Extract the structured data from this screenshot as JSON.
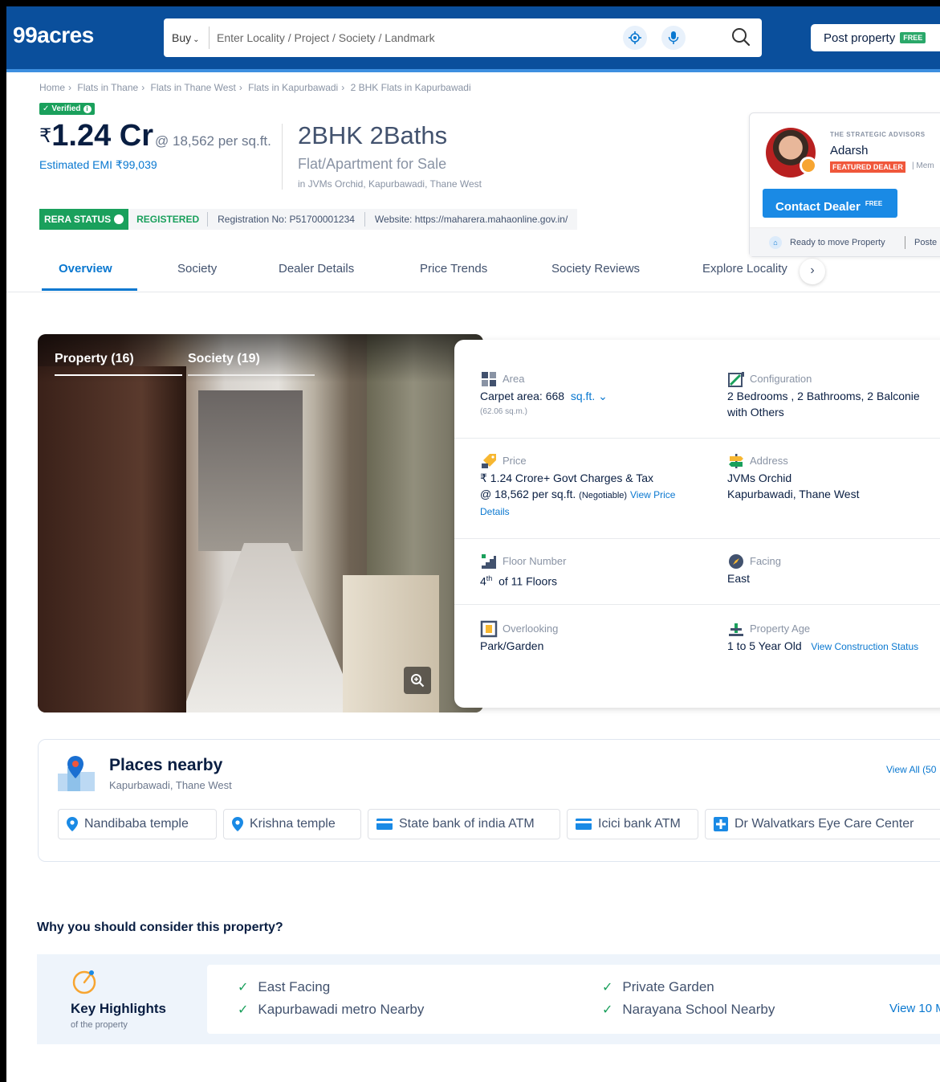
{
  "header": {
    "logo": "99acres",
    "search": {
      "mode": "Buy",
      "placeholder": "Enter Locality / Project / Society / Landmark"
    },
    "post_property": "Post property",
    "post_badge": "FREE"
  },
  "breadcrumb": [
    "Home",
    "Flats in Thane",
    "Flats in Thane West",
    "Flats in Kapurbawadi",
    "2 BHK Flats in Kapurbawadi"
  ],
  "verified": "Verified",
  "price": {
    "currency": "₹",
    "amount": "1.24 Cr",
    "per_sqft": "@ 18,562 per sq.ft.",
    "emi": "Estimated EMI ₹99,039"
  },
  "title": {
    "bhk": "2BHK 2Baths",
    "type": "Flat/Apartment for Sale",
    "location": "in JVMs Orchid, Kapurbawadi, Thane West"
  },
  "rera": {
    "label": "RERA STATUS",
    "status": "REGISTERED",
    "registration": "Registration No: P51700001234",
    "website": "Website: https://maharera.mahaonline.gov.in/"
  },
  "dealer": {
    "company": "THE STRATEGIC ADVISORS",
    "name": "Adarsh",
    "badge": "FEATURED DEALER",
    "member": "Mem",
    "contact_label": "Contact Dealer",
    "contact_badge": "FREE",
    "foot_left": "Ready to move Property",
    "foot_right": "Poste"
  },
  "tabs": [
    "Overview",
    "Society",
    "Dealer Details",
    "Price Trends",
    "Society Reviews",
    "Explore Locality"
  ],
  "gallery": {
    "tab_property": "Property (16)",
    "tab_society": "Society (19)"
  },
  "details": {
    "area": {
      "label": "Area",
      "value": "Carpet area: 668",
      "unit": "sq.ft.",
      "sub": "(62.06 sq.m.)"
    },
    "configuration": {
      "label": "Configuration",
      "line1": "2 Bedrooms , 2 Bathrooms, 2 Balconie",
      "line2": "with Others"
    },
    "price": {
      "label": "Price",
      "line1": "₹ 1.24 Crore+ Govt Charges & Tax",
      "line2": "@ 18,562 per sq.ft.",
      "neg": "(Negotiable)",
      "link1": "View Price",
      "link2": "Details"
    },
    "address": {
      "label": "Address",
      "line1": "JVMs Orchid",
      "line2": "Kapurbawadi, Thane West"
    },
    "floor": {
      "label": "Floor Number",
      "num": "4",
      "sup": "th",
      "rest": "of 11 Floors"
    },
    "facing": {
      "label": "Facing",
      "value": "East"
    },
    "overlooking": {
      "label": "Overlooking",
      "value": "Park/Garden"
    },
    "age": {
      "label": "Property Age",
      "value": "1 to 5 Year Old",
      "link": "View Construction Status"
    }
  },
  "places": {
    "title": "Places nearby",
    "subtitle": "Kapurbawadi, Thane West",
    "view_all": "View All (50",
    "chips": [
      {
        "label": "Nandibaba temple",
        "icon": "map-pin-icon"
      },
      {
        "label": "Krishna temple",
        "icon": "map-pin-icon"
      },
      {
        "label": "State bank of india ATM",
        "icon": "atm-card-icon"
      },
      {
        "label": "Icici bank ATM",
        "icon": "atm-card-icon"
      },
      {
        "label": "Dr Walvatkars Eye Care Center",
        "icon": "medical-cross-icon"
      }
    ]
  },
  "why": {
    "heading": "Why you should consider this property?",
    "title": "Key Highlights",
    "subtitle": "of the property",
    "highlights": [
      "East Facing",
      "Private Garden",
      "Kapurbawadi metro Nearby",
      "Narayana School Nearby"
    ],
    "view_more": "View 10 M"
  },
  "colors": {
    "brand_blue": "#0a4f9c",
    "accent_blue": "#0a78d0",
    "rera_green": "#1aa05c",
    "featured_orange": "#f0573b"
  }
}
